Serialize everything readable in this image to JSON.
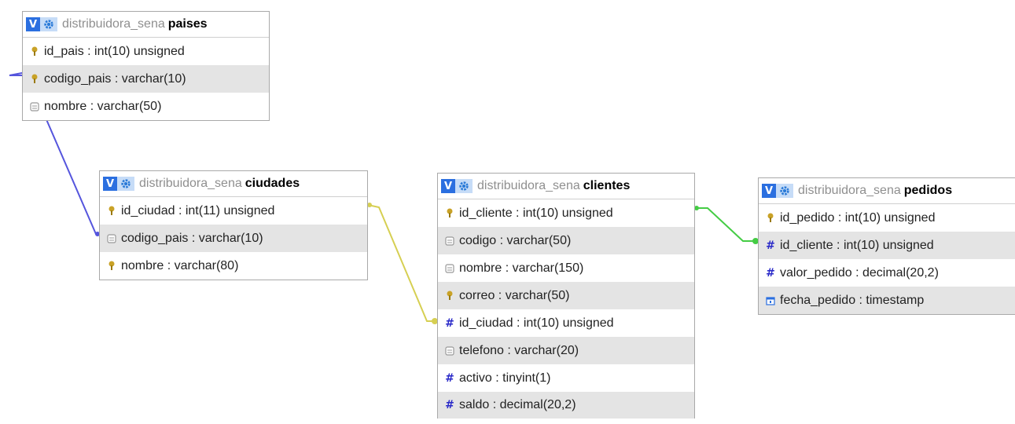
{
  "tables": [
    {
      "id": "paises",
      "db": "distribuidora_sena",
      "name": "paises",
      "columns": [
        {
          "text": "id_pais : int(10) unsigned",
          "icon": "key-icon"
        },
        {
          "text": "codigo_pais : varchar(10)",
          "icon": "key-icon"
        },
        {
          "text": "nombre : varchar(50)",
          "icon": "column-icon"
        }
      ]
    },
    {
      "id": "ciudades",
      "db": "distribuidora_sena",
      "name": "ciudades",
      "columns": [
        {
          "text": "id_ciudad : int(11) unsigned",
          "icon": "key-icon"
        },
        {
          "text": "codigo_pais : varchar(10)",
          "icon": "column-icon"
        },
        {
          "text": "nombre : varchar(80)",
          "icon": "key-icon"
        }
      ]
    },
    {
      "id": "clientes",
      "db": "distribuidora_sena",
      "name": "clientes",
      "columns": [
        {
          "text": "id_cliente : int(10) unsigned",
          "icon": "key-icon"
        },
        {
          "text": "codigo : varchar(50)",
          "icon": "column-icon"
        },
        {
          "text": "nombre : varchar(150)",
          "icon": "column-icon"
        },
        {
          "text": "correo : varchar(50)",
          "icon": "key-icon"
        },
        {
          "text": "id_ciudad : int(10) unsigned",
          "icon": "hash-icon"
        },
        {
          "text": "telefono : varchar(20)",
          "icon": "column-icon"
        },
        {
          "text": "activo : tinyint(1)",
          "icon": "hash-icon"
        },
        {
          "text": "saldo : decimal(20,2)",
          "icon": "hash-icon"
        }
      ]
    },
    {
      "id": "pedidos",
      "db": "distribuidora_sena",
      "name": "pedidos",
      "columns": [
        {
          "text": "id_pedido : int(10) unsigned",
          "icon": "key-icon"
        },
        {
          "text": "id_cliente : int(10) unsigned",
          "icon": "hash-icon"
        },
        {
          "text": "valor_pedido : decimal(20,2)",
          "icon": "hash-icon"
        },
        {
          "text": "fecha_pedido : timestamp",
          "icon": "calendar-icon"
        }
      ]
    }
  ],
  "relations": [
    {
      "from": "paises.id_pais",
      "to": "ciudades.codigo_pais",
      "color": "#5555dd"
    },
    {
      "from": "ciudades.id_ciudad",
      "to": "clientes.id_ciudad",
      "color": "#d6cf52"
    },
    {
      "from": "clientes.id_cliente",
      "to": "pedidos.id_cliente",
      "color": "#44cc44"
    }
  ],
  "colors": {
    "accent": "#2b6fe0",
    "row_alt": "#e4e4e4"
  }
}
